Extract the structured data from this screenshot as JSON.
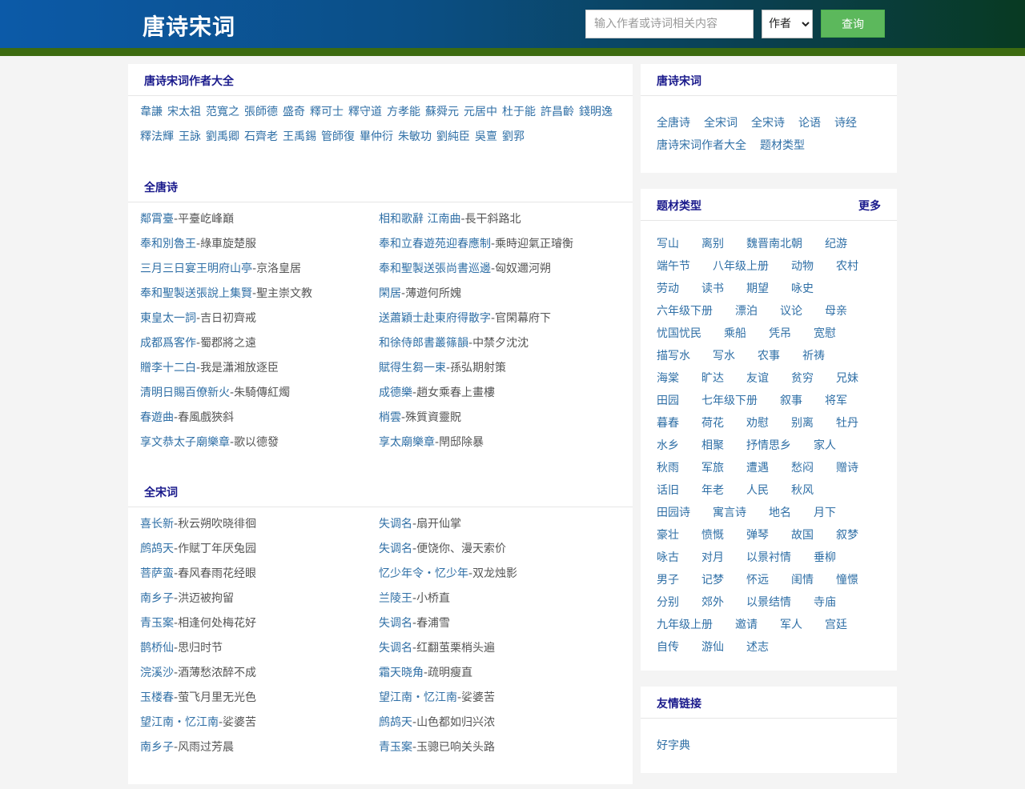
{
  "header": {
    "logo": "唐诗宋词",
    "search_placeholder": "输入作者或诗词相关内容",
    "select_value": "作者",
    "search_button": "查询"
  },
  "authors_section": {
    "title": "唐诗宋词作者大全",
    "authors": [
      "韋謙",
      "宋太祖",
      "范寬之",
      "張師德",
      "盛奇",
      "釋可士",
      "釋守道",
      "方孝能",
      "蘇舜元",
      "元居中",
      "杜于能",
      "許昌齡",
      "錢明逸",
      "釋法輝",
      "王詠",
      "劉禹卿",
      "石齊老",
      "王禹錫",
      "管師復",
      "畢仲衍",
      "朱敏功",
      "劉純臣",
      "吳亶",
      "劉郛"
    ]
  },
  "tang_section": {
    "title": "全唐诗",
    "poems": [
      {
        "title": "鄰霄臺",
        "line": "平臺屹峰巔"
      },
      {
        "title": "相和歌辭 江南曲",
        "line": "長干斜路北"
      },
      {
        "title": "奉和別魯王",
        "line": "綠車旋楚服"
      },
      {
        "title": "奉和立春遊苑迎春應制",
        "line": "乘時迎氣正璿衡"
      },
      {
        "title": "三月三日宴王明府山亭",
        "line": "京洛皇居"
      },
      {
        "title": "奉和聖製送張尚書巡邊",
        "line": "匈奴邇河朔"
      },
      {
        "title": "奉和聖製送張說上集賢",
        "line": "聖主崇文教"
      },
      {
        "title": "閑居",
        "line": "薄遊何所媿"
      },
      {
        "title": "東皇太一詞",
        "line": "吉日初齊戒"
      },
      {
        "title": "送蕭穎士赴東府得散字",
        "line": "官閑幕府下"
      },
      {
        "title": "成都爲客作",
        "line": "蜀郡將之遠"
      },
      {
        "title": "和徐侍郎書叢篠韻",
        "line": "中禁夕沈沈"
      },
      {
        "title": "贈李十二白",
        "line": "我是瀟湘放逐臣"
      },
      {
        "title": "賦得生芻一束",
        "line": "孫弘期射策"
      },
      {
        "title": "清明日賜百僚新火",
        "line": "朱騎傳紅燭"
      },
      {
        "title": "成德樂",
        "line": "趙女乘春上畫樓"
      },
      {
        "title": "春遊曲",
        "line": "春風戲狹斜"
      },
      {
        "title": "梢雲",
        "line": "殊質資靈貺"
      },
      {
        "title": "享文恭太子廟樂章",
        "line": "歌以德發"
      },
      {
        "title": "享太廟樂章",
        "line": "閈邸除暴"
      }
    ]
  },
  "song_section": {
    "title": "全宋词",
    "poems": [
      {
        "title": "喜长新",
        "line": "秋云朔吹晓徘徊"
      },
      {
        "title": "失调名",
        "line": "扇开仙掌"
      },
      {
        "title": "鹧鸪天",
        "line": "作赋丁年厌兔园"
      },
      {
        "title": "失调名",
        "line": "便饶你、漫天索价"
      },
      {
        "title": "菩萨蛮",
        "line": "春风春雨花经眼"
      },
      {
        "title": "忆少年令・忆少年",
        "line": "双龙烛影"
      },
      {
        "title": "南乡子",
        "line": "洪迈被拘留"
      },
      {
        "title": "兰陵王",
        "line": "小桥直"
      },
      {
        "title": "青玉案",
        "line": "相逢何处梅花好"
      },
      {
        "title": "失调名",
        "line": "春浦雪"
      },
      {
        "title": "鹊桥仙",
        "line": "思归时节"
      },
      {
        "title": "失调名",
        "line": "红翻茧栗梢头遍"
      },
      {
        "title": "浣溪沙",
        "line": "酒薄愁浓醉不成"
      },
      {
        "title": "霜天晓角",
        "line": "疏明瘦直"
      },
      {
        "title": "玉楼春",
        "line": "萤飞月里无光色"
      },
      {
        "title": "望江南・忆江南",
        "line": "娑婆苦"
      },
      {
        "title": "望江南・忆江南",
        "line": "娑婆苦"
      },
      {
        "title": "鹧鸪天",
        "line": "山色都如归兴浓"
      },
      {
        "title": "南乡子",
        "line": "风雨过芳晨"
      },
      {
        "title": "青玉案",
        "line": "玉骢已响关头路"
      }
    ]
  },
  "sidebar": {
    "nav": {
      "title": "唐诗宋词",
      "links": [
        "全唐诗",
        "全宋词",
        "全宋诗",
        "论语",
        "诗经",
        "唐诗宋词作者大全",
        "题材类型"
      ]
    },
    "topics": {
      "title": "题材类型",
      "more": "更多",
      "items": [
        "写山",
        "离别",
        "魏晋南北朝",
        "纪游",
        "端午节",
        "八年级上册",
        "动物",
        "农村",
        "劳动",
        "读书",
        "期望",
        "咏史",
        "六年级下册",
        "漂泊",
        "议论",
        "母亲",
        "忧国忧民",
        "乘船",
        "凭吊",
        "宽慰",
        "描写水",
        "写水",
        "农事",
        "祈祷",
        "海棠",
        "旷达",
        "友谊",
        "贫穷",
        "兄妹",
        "田园",
        "七年级下册",
        "叙事",
        "将军",
        "暮春",
        "荷花",
        "劝慰",
        "别离",
        "牡丹",
        "水乡",
        "相聚",
        "抒情思乡",
        "家人",
        "秋雨",
        "军旅",
        "遭遇",
        "愁闷",
        "赠诗",
        "话旧",
        "年老",
        "人民",
        "秋风",
        "田园诗",
        "寓言诗",
        "地名",
        "月下",
        "豪壮",
        "愤慨",
        "弹琴",
        "故国",
        "叙梦",
        "咏古",
        "对月",
        "以景衬情",
        "垂柳",
        "男子",
        "记梦",
        "怀远",
        "闺情",
        "憧憬",
        "分别",
        "郊外",
        "以景结情",
        "寺庙",
        "九年级上册",
        "邀请",
        "军人",
        "宫廷",
        "自传",
        "游仙",
        "述志"
      ]
    },
    "friends": {
      "title": "友情链接",
      "links": [
        "好字典"
      ]
    }
  }
}
